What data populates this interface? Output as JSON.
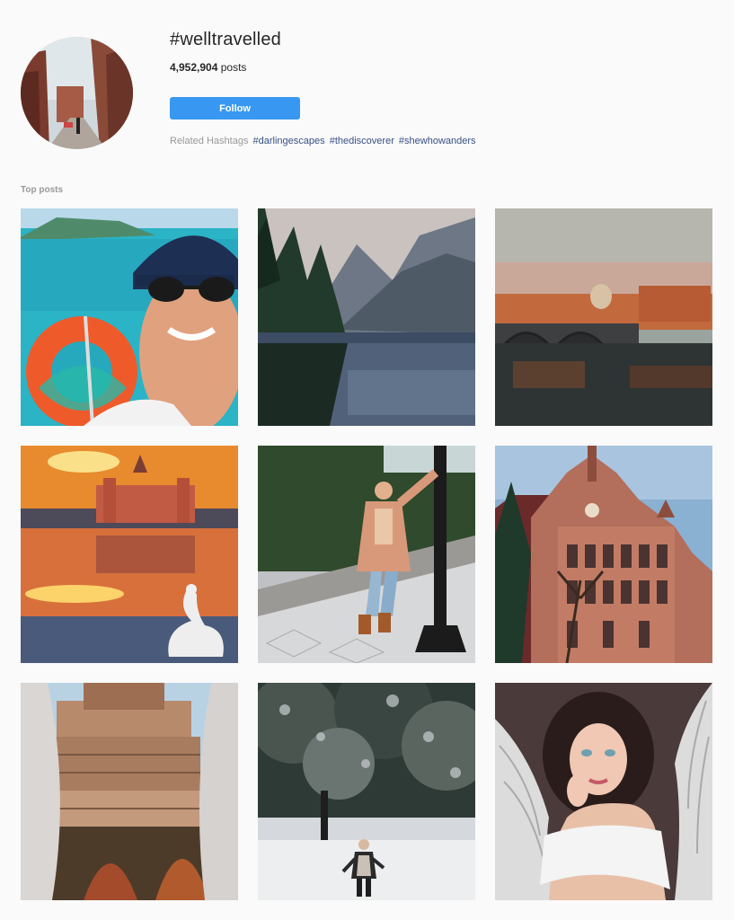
{
  "header": {
    "hashtag": "#welltravelled",
    "post_count": "4,952,904",
    "posts_word": "posts",
    "follow_label": "Follow",
    "related_label": "Related Hashtags",
    "related_tags": [
      "#darlingescapes",
      "#thediscoverer",
      "#shewhowanders"
    ]
  },
  "section": {
    "label": "Top posts"
  },
  "posts": [
    {
      "scene": "selfie-on-boat-with-life-ring"
    },
    {
      "scene": "mountain-lake-with-pine-forest"
    },
    {
      "scene": "bridge-over-river-at-dusk"
    },
    {
      "scene": "palace-reflection-at-sunset-with-swan"
    },
    {
      "scene": "woman-posing-by-lamp-post"
    },
    {
      "scene": "gothic-town-hall-building"
    },
    {
      "scene": "round-castle-framed-by-columns"
    },
    {
      "scene": "person-walking-in-snowy-forest"
    },
    {
      "scene": "woman-with-angel-wings"
    }
  ],
  "colors": {
    "accent": "#3897f0",
    "link": "#385185",
    "muted": "#999999",
    "background": "#fafafa"
  }
}
